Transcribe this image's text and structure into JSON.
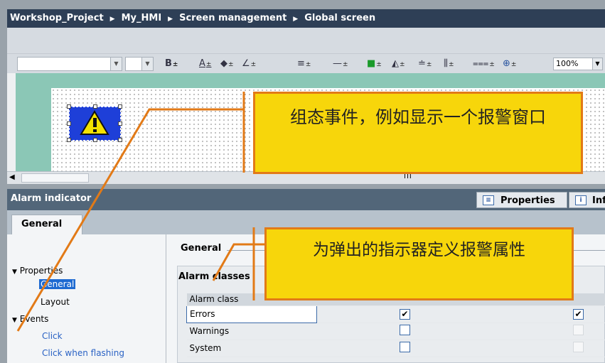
{
  "breadcrumb": [
    "Workshop_Project",
    "My_HMI",
    "Screen management",
    "Global screen"
  ],
  "breadcrumb_separator": "▶",
  "toolbar": {
    "text_formats": [
      "B",
      "A",
      "◆",
      "∠",
      "≡",
      "—",
      "■",
      "◭",
      "≐",
      "⫼",
      "⩶",
      "⊕"
    ],
    "dropdown_glyph": "±",
    "zoom": "100%"
  },
  "canvas": {
    "scroll_grip": "III"
  },
  "inspector": {
    "title": "Alarm indicator",
    "properties_tab": "Properties",
    "info_tab": "Inf",
    "general_tab": "General"
  },
  "nav": {
    "properties": "Properties",
    "general": "General",
    "layout": "Layout",
    "events": "Events",
    "click": "Click",
    "click_when_flashing": "Click when flashing"
  },
  "content": {
    "section_title": "General",
    "alarm_classes_title": "Alarm classes",
    "column_header": "Alarm class",
    "rows": [
      {
        "name": "Errors",
        "col1": true,
        "col2": true
      },
      {
        "name": "Warnings",
        "col1": false,
        "col2": false
      },
      {
        "name": "System",
        "col1": false,
        "col2": false
      }
    ]
  },
  "callouts": {
    "top": "组态事件，例如显示一个报警窗口",
    "bottom": "为弹出的指示器定义报警属性"
  },
  "colors": {
    "callout_fill": "#f7d60b",
    "callout_border": "#e27a17",
    "title_bar": "#2e3f56",
    "selected_nav": "#1e6ad1"
  }
}
